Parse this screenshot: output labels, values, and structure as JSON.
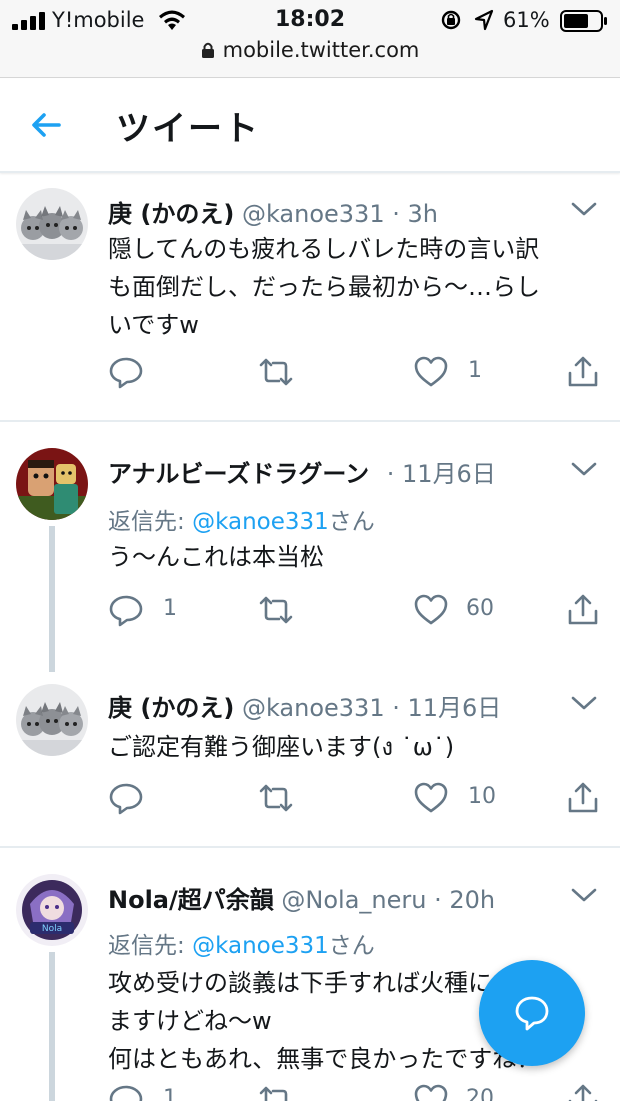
{
  "status_bar": {
    "carrier": "Y!mobile",
    "time": "18:02",
    "battery": "61%",
    "url": "mobile.twitter.com"
  },
  "header": {
    "title": "ツイート"
  },
  "tweets": [
    {
      "name": "庚 (かのえ)",
      "handle": "@kanoe331",
      "time": "· 3h",
      "body": [
        "隠してんのも疲れるしバレた時の言い訳",
        "も面倒だし、だったら最初から〜…らし",
        "いですw"
      ],
      "replies": "",
      "likes": "1"
    },
    {
      "name": "アナルビーズドラグーン",
      "handle": "",
      "time": "· 11月6日",
      "reply_label": "返信先: ",
      "reply_mention": "@kanoe331",
      "reply_suffix": "さん",
      "body": [
        "う〜んこれは本当松"
      ],
      "replies": "1",
      "likes": "60"
    },
    {
      "name": "庚 (かのえ)",
      "handle": "@kanoe331",
      "time": "· 11月6日",
      "body": [
        "ご認定有難う御座います(ง ˙ω˙)"
      ],
      "replies": "",
      "likes": "10"
    },
    {
      "name": "Nola/超パ余韻",
      "handle": "@Nola_neru",
      "time": "· 20h",
      "reply_label": "返信先: ",
      "reply_mention": "@kanoe331",
      "reply_suffix": "さん",
      "body": [
        "攻め受けの談義は下手すれば火種になり",
        "ますけどね〜w",
        "何はともあれ、無事で良かったですね！"
      ],
      "replies": "1",
      "likes": "20"
    }
  ],
  "colors": {
    "accent": "#1da1f2",
    "secondary_text": "#657786",
    "divider": "#e6ecf0"
  }
}
